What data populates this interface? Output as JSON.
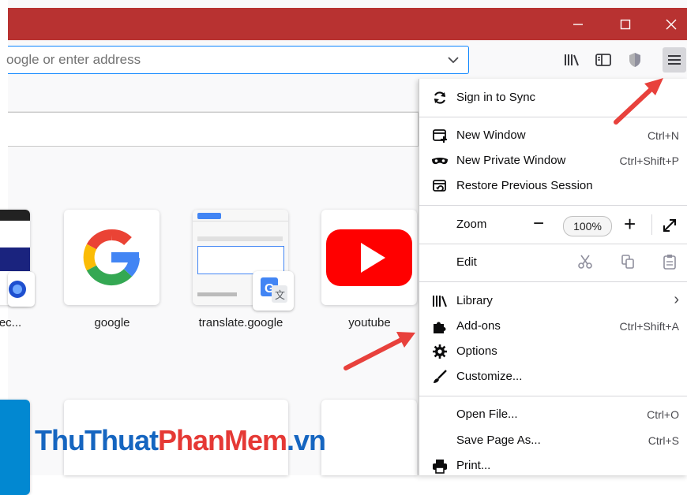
{
  "window": {
    "minimize_icon": "minimize-icon",
    "maximize_icon": "maximize-icon",
    "close_icon": "close-icon",
    "titlebar_color": "#b83231"
  },
  "urlbar": {
    "text": "oogle or enter address",
    "accent": "#0a84ff"
  },
  "toolbar": {
    "icons": [
      "library-icon",
      "sidebar-icon",
      "tracking-protection-icon",
      "hamburger-menu-icon"
    ]
  },
  "tiles": [
    {
      "label": "ec..."
    },
    {
      "label": "google"
    },
    {
      "label": "translate.google"
    },
    {
      "label": "youtube"
    }
  ],
  "menu": {
    "sign_in": "Sign in to Sync",
    "new_window": {
      "label": "New Window",
      "shortcut": "Ctrl+N"
    },
    "new_private": {
      "label": "New Private Window",
      "shortcut": "Ctrl+Shift+P"
    },
    "restore": {
      "label": "Restore Previous Session"
    },
    "zoom": {
      "label": "Zoom",
      "minus": "−",
      "value": "100%",
      "plus": "+"
    },
    "edit": {
      "label": "Edit"
    },
    "library": {
      "label": "Library",
      "chevron": "›"
    },
    "addons": {
      "label": "Add-ons",
      "shortcut": "Ctrl+Shift+A"
    },
    "options": {
      "label": "Options"
    },
    "customize": {
      "label": "Customize..."
    },
    "open_file": {
      "label": "Open File...",
      "shortcut": "Ctrl+O"
    },
    "save_page": {
      "label": "Save Page As...",
      "shortcut": "Ctrl+S"
    },
    "print": {
      "label": "Print..."
    }
  },
  "watermark": {
    "part1": "ThuThuat",
    "part2": "PhanMem",
    "part3": ".vn"
  },
  "annotation_color": "#e8413c"
}
